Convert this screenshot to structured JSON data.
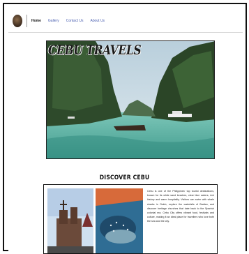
{
  "nav": {
    "links": [
      "Home",
      "Gallery",
      "Contact Us",
      "About Us"
    ],
    "active_index": 0
  },
  "hero": {
    "title": "CEBU TRAVELS"
  },
  "section": {
    "heading": "DISCOVER CEBU",
    "body": "Cebu is one of the Philippines' top tourist destinations, known for its white sand beaches, clear blue waters, rich history and warm hospitality. Visitors can swim with whale sharks in Oslob, explore the waterfalls of Badian, and discover heritage churches that date back to the Spanish colonial era. Cebu City offers vibrant food, festivals and culture, making it an ideal place for travellers who love both the sea and the city."
  },
  "colors": {
    "nav_link": "#4a5fb0",
    "sea": "#5fb8a8",
    "cliff": "#2f4a2a",
    "sky": "#c9dbe6"
  }
}
